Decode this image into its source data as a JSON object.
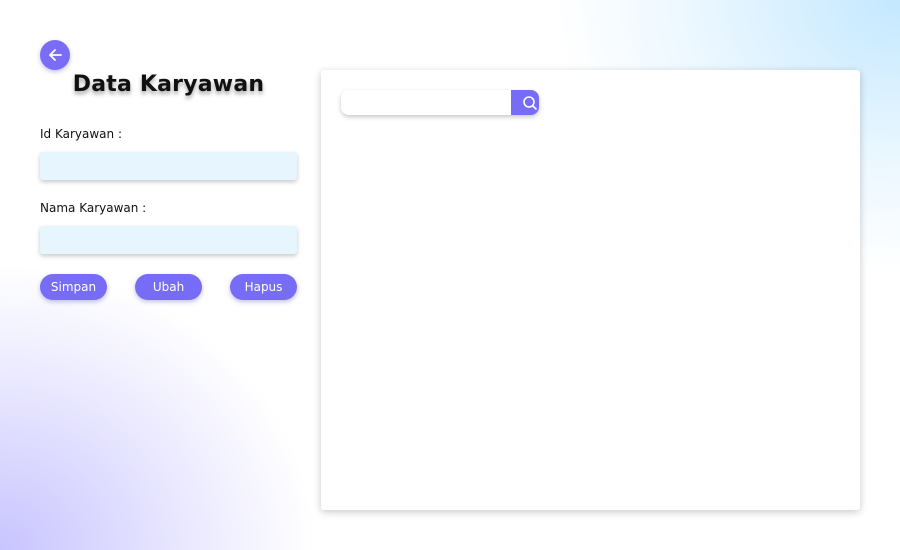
{
  "icons": {
    "back": "arrow-left-icon",
    "search": "search-icon"
  },
  "colors": {
    "accent": "#776cf5",
    "input_bg": "#e6f5fe"
  },
  "form": {
    "title": "Data Karyawan",
    "id_label": "Id Karyawan :",
    "id_value": "",
    "name_label": "Nama Karyawan :",
    "name_value": ""
  },
  "actions": {
    "save": "Simpan",
    "edit": "Ubah",
    "delete": "Hapus"
  },
  "search": {
    "value": ""
  }
}
